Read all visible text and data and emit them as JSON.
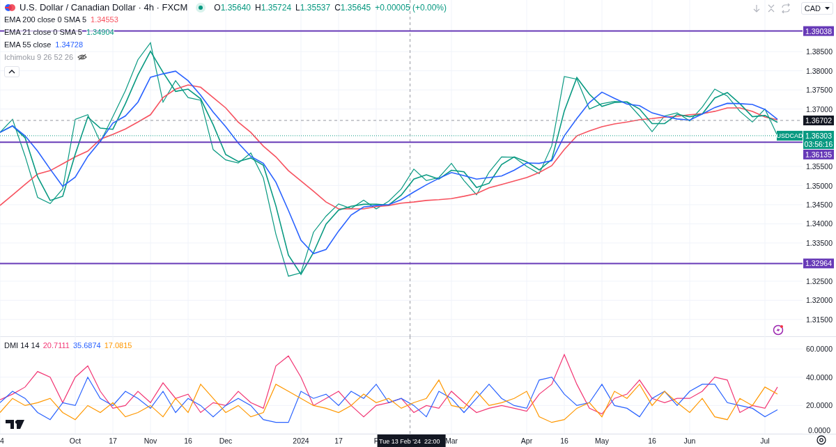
{
  "header": {
    "title": "U.S. Dollar / Canadian Dollar · 4h · FXCM",
    "market_open": true,
    "ohlc": [
      {
        "letter": "O",
        "value": "1.35640"
      },
      {
        "letter": "H",
        "value": "1.35724"
      },
      {
        "letter": "L",
        "value": "1.35537"
      },
      {
        "letter": "C",
        "value": "1.35645"
      }
    ],
    "change": "+0.00005 (+0.00%)"
  },
  "indicators": [
    {
      "kind": "ema",
      "label": "EMA 200 close 0 SMA 5",
      "value": "1.34553",
      "color": "#f7525f"
    },
    {
      "kind": "ema",
      "label": "EMA 21 close 0 SMA 5",
      "value": "1.34904",
      "color": "#089981"
    },
    {
      "kind": "ema",
      "label": "EMA 55 close",
      "value": "1.34728",
      "color": "#2962ff"
    },
    {
      "kind": "hidden",
      "label": "Ichimoku 9 26 52 26"
    }
  ],
  "currency": "CAD",
  "main_chart": {
    "countdown": "03:56:16",
    "chart_data": {
      "type": "line",
      "grid": true,
      "series": [
        {
          "name": "USDCAD",
          "color": "#089981",
          "values": [
            1.3639,
            1.3673,
            1.3577,
            1.3469,
            1.3453,
            1.3491,
            1.3673,
            1.3685,
            1.3614,
            1.368,
            1.3748,
            1.3829,
            1.3873,
            1.3718,
            1.3774,
            1.373,
            1.3723,
            1.3594,
            1.3567,
            1.3559,
            1.3585,
            1.352,
            1.3373,
            1.3263,
            1.3272,
            1.3378,
            1.342,
            1.3452,
            1.344,
            1.3462,
            1.3439,
            1.3459,
            1.3491,
            1.3543,
            1.3513,
            1.3521,
            1.3558,
            1.3513,
            1.3476,
            1.3535,
            1.3575,
            1.3574,
            1.355,
            1.3531,
            1.3604,
            1.3785,
            1.3778,
            1.37,
            1.3714,
            1.372,
            1.3718,
            1.3682,
            1.3641,
            1.3682,
            1.369,
            1.3669,
            1.3705,
            1.3752,
            1.3734,
            1.3694,
            1.3666,
            1.37,
            1.363
          ]
        },
        {
          "color": "#f7525f",
          "values": [
            1.3448,
            1.3475,
            1.3503,
            1.353,
            1.3539,
            1.3557,
            1.3575,
            1.359,
            1.3621,
            1.3634,
            1.3648,
            1.3666,
            1.3685,
            1.373,
            1.3752,
            1.3763,
            1.3757,
            1.373,
            1.3703,
            1.3666,
            1.3639,
            1.3603,
            1.3575,
            1.3539,
            1.3512,
            1.3485,
            1.3457,
            1.3439,
            1.3439,
            1.3439,
            1.3445,
            1.3448,
            1.3454,
            1.3457,
            1.3461,
            1.3463,
            1.3466,
            1.3472,
            1.3479,
            1.3494,
            1.3503,
            1.3512,
            1.3521,
            1.3534,
            1.3552,
            1.3594,
            1.363,
            1.3643,
            1.3654,
            1.3661,
            1.3666,
            1.3672,
            1.3675,
            1.3679,
            1.3681,
            1.3685,
            1.3688,
            1.3694,
            1.3703,
            1.3703,
            1.3694,
            1.3679,
            1.3672
          ]
        },
        {
          "color": "#089981",
          "values": [
            1.3639,
            1.3656,
            1.3625,
            1.3523,
            1.3461,
            1.3472,
            1.3582,
            1.3679,
            1.365,
            1.3647,
            1.3714,
            1.3789,
            1.3851,
            1.3796,
            1.3746,
            1.3752,
            1.3727,
            1.3659,
            1.3581,
            1.3563,
            1.3572,
            1.3553,
            1.3447,
            1.3318,
            1.3268,
            1.3325,
            1.3399,
            1.3436,
            1.3446,
            1.3451,
            1.3451,
            1.3449,
            1.3475,
            1.3517,
            1.3528,
            1.3517,
            1.354,
            1.3536,
            1.3495,
            1.3506,
            1.3555,
            1.3575,
            1.3562,
            1.3541,
            1.3568,
            1.3695,
            1.3782,
            1.3739,
            1.3707,
            1.3717,
            1.3719,
            1.37,
            1.3662,
            1.3662,
            1.3686,
            1.368,
            1.3687,
            1.3729,
            1.3743,
            1.3714,
            1.368,
            1.3683,
            1.3665
          ]
        },
        {
          "color": "#2962ff",
          "values": [
            1.3639,
            1.3656,
            1.363,
            1.359,
            1.3543,
            1.3498,
            1.3522,
            1.3576,
            1.3616,
            1.3663,
            1.3682,
            1.3718,
            1.3783,
            1.3792,
            1.3799,
            1.3774,
            1.3736,
            1.3692,
            1.3654,
            1.3611,
            1.3576,
            1.3558,
            1.3509,
            1.3435,
            1.3357,
            1.3322,
            1.3333,
            1.3381,
            1.3423,
            1.3444,
            1.3448,
            1.345,
            1.3463,
            1.3483,
            1.3502,
            1.3519,
            1.3534,
            1.3526,
            1.3517,
            1.3521,
            1.3525,
            1.354,
            1.3559,
            1.3558,
            1.3565,
            1.363,
            1.3675,
            1.3717,
            1.3744,
            1.3728,
            1.3713,
            1.3709,
            1.369,
            1.3681,
            1.3674,
            1.3671,
            1.3687,
            1.3704,
            1.3715,
            1.3714,
            1.3712,
            1.3699,
            1.3673
          ]
        }
      ],
      "ylim": [
        1.3106,
        1.3985
      ],
      "yticks": [
        {
          "value": 1.385,
          "label": "1.38500"
        },
        {
          "value": 1.38,
          "label": "1.38000"
        },
        {
          "value": 1.375,
          "label": "1.37500"
        },
        {
          "value": 1.37,
          "label": "1.37000"
        },
        {
          "value": 1.355,
          "label": "1.35500"
        },
        {
          "value": 1.35,
          "label": "1.35000"
        },
        {
          "value": 1.345,
          "label": "1.34500"
        },
        {
          "value": 1.34,
          "label": "1.34000"
        },
        {
          "value": 1.335,
          "label": "1.33500"
        },
        {
          "value": 1.325,
          "label": "1.32500"
        },
        {
          "value": 1.32,
          "label": "1.32000"
        },
        {
          "value": 1.315,
          "label": "1.31500"
        }
      ],
      "ref_lines": [
        {
          "axis": "y",
          "value": 1.39038,
          "label": "1.39038",
          "color": "#673ab7"
        },
        {
          "axis": "y",
          "value": 1.36135,
          "label": "1.36135",
          "color": "#673ab7"
        },
        {
          "axis": "y",
          "value": 1.32964,
          "label": "1.32964",
          "color": "#673ab7"
        },
        {
          "axis": "y",
          "value": 1.36702,
          "label": "1.36702",
          "color": "#9598a1"
        },
        {
          "axis": "y",
          "value": 1.36303,
          "label": "1.36303",
          "color": "#089981"
        }
      ]
    }
  },
  "dmi": {
    "label": "DMI 14 14",
    "readings": [
      {
        "value": "20.7111",
        "color": "#f23674"
      },
      {
        "value": "35.6874",
        "color": "#2962ff"
      },
      {
        "value": "17.0815",
        "color": "#ff9800"
      }
    ],
    "chart_data": {
      "type": "line",
      "grid": true,
      "categories": [
        "4",
        null,
        null,
        null,
        null,
        null,
        "Oct",
        null,
        null,
        "17",
        null,
        null,
        "Nov",
        null,
        null,
        "16",
        null,
        null,
        "Dec",
        null,
        null,
        null,
        null,
        null,
        "2024",
        null,
        null,
        "17",
        null,
        null,
        "F",
        null,
        null,
        null,
        null,
        null,
        "Mar",
        null,
        null,
        null,
        null,
        null,
        "Apr",
        null,
        null,
        "16",
        null,
        null,
        "May",
        null,
        null,
        null,
        "16",
        null,
        null,
        "Jun",
        null,
        null,
        null,
        null,
        null,
        "Jul",
        null
      ],
      "series": [
        {
          "color": "#f23674",
          "values": [
            24,
            28,
            33,
            44,
            40,
            22,
            40,
            48,
            30,
            18,
            20,
            30,
            22,
            36,
            25,
            28,
            15,
            22,
            20,
            30,
            22,
            18,
            48,
            55,
            40,
            20,
            25,
            30,
            20,
            12,
            20,
            22,
            25,
            15,
            20,
            18,
            30,
            22,
            15,
            18,
            20,
            18,
            16,
            28,
            35,
            56,
            35,
            18,
            14,
            25,
            28,
            38,
            25,
            22,
            25,
            25,
            30,
            40,
            38,
            15,
            20,
            18,
            33
          ]
        },
        {
          "color": "#2962ff",
          "values": [
            22,
            30,
            25,
            15,
            10,
            22,
            20,
            40,
            25,
            20,
            30,
            25,
            18,
            30,
            15,
            25,
            20,
            12,
            20,
            25,
            20,
            10,
            8,
            8,
            30,
            25,
            28,
            20,
            30,
            25,
            35,
            22,
            25,
            20,
            12,
            30,
            25,
            15,
            25,
            35,
            25,
            20,
            18,
            38,
            40,
            28,
            20,
            22,
            35,
            20,
            18,
            12,
            25,
            30,
            20,
            30,
            35,
            35,
            22,
            20,
            18,
            12,
            17
          ]
        },
        {
          "color": "#ff9800",
          "values": [
            15,
            25,
            20,
            22,
            25,
            15,
            10,
            20,
            15,
            22,
            12,
            15,
            20,
            12,
            25,
            15,
            35,
            25,
            15,
            20,
            12,
            15,
            35,
            30,
            25,
            20,
            18,
            15,
            20,
            28,
            22,
            25,
            18,
            22,
            25,
            38,
            20,
            18,
            30,
            20,
            22,
            25,
            30,
            12,
            8,
            10,
            18,
            22,
            12,
            30,
            25,
            35,
            20,
            30,
            22,
            15,
            25,
            12,
            10,
            25,
            20,
            33,
            28
          ]
        }
      ],
      "ylim": [
        0,
        68.9
      ],
      "yticks": [
        {
          "value": 60,
          "label": "60.0000"
        },
        {
          "value": 40,
          "label": "40.0000"
        },
        {
          "value": 20,
          "label": "20.0000"
        },
        {
          "value": 0,
          "label": "0.0000"
        }
      ],
      "annotations": [
        "Tue 13 Feb '24  22:00"
      ]
    }
  }
}
